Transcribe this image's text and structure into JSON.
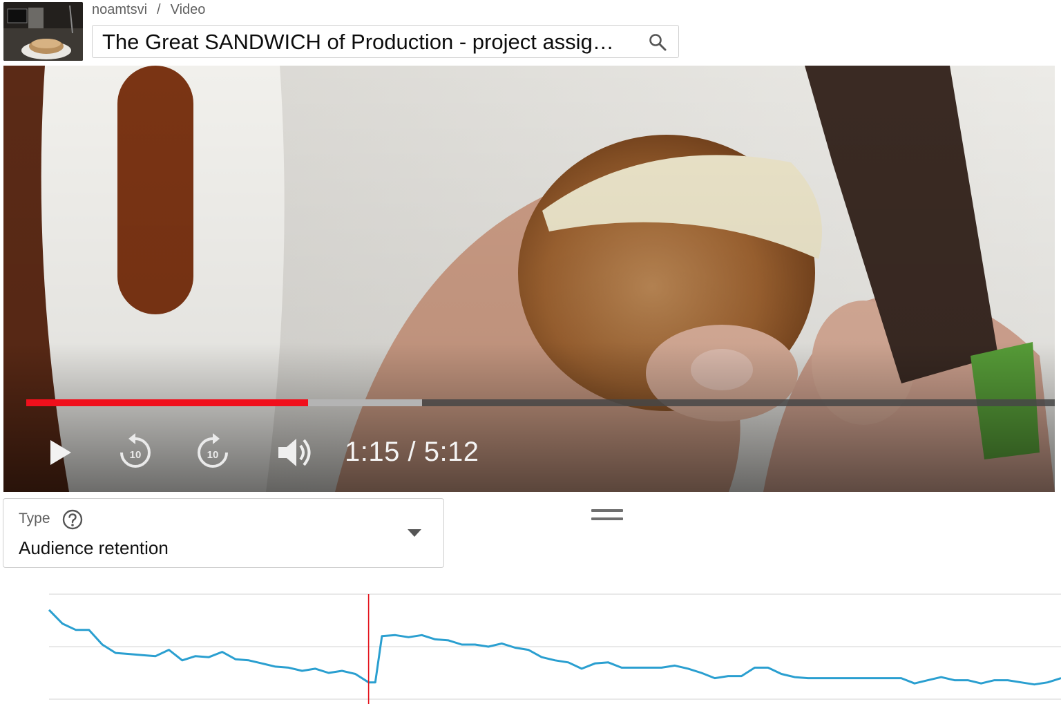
{
  "header": {
    "breadcrumb": {
      "channel": "noamtsvi",
      "separator": "/",
      "section": "Video"
    },
    "video_title": "The Great SANDWICH of Production - project assig…",
    "search_icon": "search-icon"
  },
  "player": {
    "time": "1:15 / 5:12",
    "progress": {
      "played_fraction": 0.274,
      "buffered_fraction": 0.385
    },
    "controls": [
      "play-icon",
      "rewind-10-icon",
      "forward-10-icon",
      "volume-icon"
    ],
    "skip_seconds": "10",
    "colors": {
      "played": "#f0101c",
      "buffered": "#b9b9b9",
      "track": "#464646"
    }
  },
  "type_select": {
    "label": "Type",
    "value": "Audience retention",
    "help_icon": "help-circle-icon",
    "caret_icon": "caret-down-icon"
  },
  "chart_data": {
    "type": "line",
    "title": "",
    "xlabel": "",
    "ylabel": "",
    "grid": true,
    "line_color": "#2a9fd0",
    "marker_color": "#e3121b",
    "current_position_fraction": 0.24,
    "x": [
      0.0,
      0.01,
      0.02,
      0.03,
      0.04,
      0.05,
      0.06,
      0.07,
      0.08,
      0.09,
      0.1,
      0.11,
      0.12,
      0.13,
      0.14,
      0.15,
      0.16,
      0.17,
      0.18,
      0.19,
      0.2,
      0.21,
      0.22,
      0.23,
      0.24,
      0.245,
      0.25,
      0.26,
      0.27,
      0.28,
      0.29,
      0.3,
      0.31,
      0.32,
      0.33,
      0.34,
      0.35,
      0.36,
      0.37,
      0.38,
      0.39,
      0.4,
      0.41,
      0.42,
      0.43,
      0.44,
      0.45,
      0.46,
      0.47,
      0.48,
      0.49,
      0.5,
      0.51,
      0.52,
      0.53,
      0.54,
      0.55,
      0.56,
      0.57,
      0.58,
      0.59,
      0.6,
      0.61,
      0.62,
      0.63,
      0.64,
      0.65,
      0.66,
      0.67,
      0.68,
      0.69,
      0.7,
      0.71,
      0.72,
      0.73,
      0.74,
      0.75,
      0.76
    ],
    "values": [
      85,
      72,
      66,
      66,
      52,
      44,
      43,
      42,
      41,
      47,
      37,
      41,
      40,
      45,
      38,
      37,
      34,
      31,
      30,
      27,
      29,
      25,
      27,
      24,
      16,
      16,
      60,
      61,
      59,
      61,
      57,
      56,
      52,
      52,
      50,
      53,
      49,
      47,
      40,
      37,
      35,
      29,
      34,
      35,
      30,
      30,
      30,
      30,
      32,
      29,
      25,
      20,
      22,
      22,
      30,
      30,
      24,
      21,
      20,
      20,
      20,
      20,
      20,
      20,
      20,
      20,
      15,
      18,
      21,
      18,
      18,
      15,
      18,
      18,
      16,
      14,
      16,
      20
    ],
    "xlim": [
      0,
      0.76
    ],
    "ylim": [
      0,
      100
    ]
  }
}
